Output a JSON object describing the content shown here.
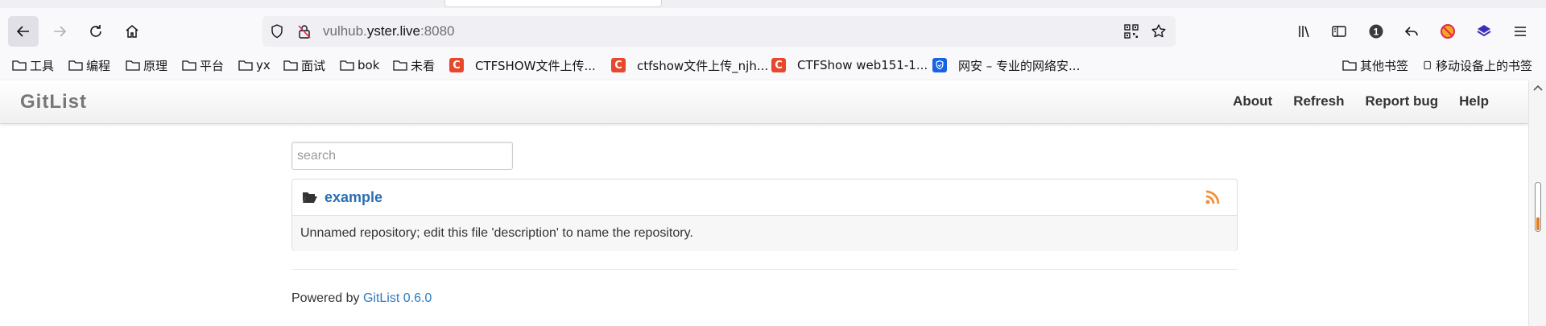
{
  "browser": {
    "url_prefix": "vulhub.",
    "url_domain": "yster.live",
    "url_port": ":8080",
    "badge_count": "1",
    "bookmarks": [
      {
        "label": "工具",
        "type": "folder"
      },
      {
        "label": "编程",
        "type": "folder"
      },
      {
        "label": "原理",
        "type": "folder"
      },
      {
        "label": "平台",
        "type": "folder"
      },
      {
        "label": "yx",
        "type": "folder"
      },
      {
        "label": "面试",
        "type": "folder"
      },
      {
        "label": "bok",
        "type": "folder"
      },
      {
        "label": "未看",
        "type": "folder"
      },
      {
        "label": "CTFSHOW文件上传...",
        "type": "site",
        "favicon": "C"
      },
      {
        "label": "ctfshow文件上传_njh...",
        "type": "site",
        "favicon": "C"
      },
      {
        "label": "CTFShow web151-1...",
        "type": "site",
        "favicon": "C"
      },
      {
        "label": "网安 – 专业的网络安...",
        "type": "site",
        "favicon": "shield"
      }
    ],
    "other_bookmarks": "其他书签",
    "mobile_bookmarks": "移动设备上的书签"
  },
  "page": {
    "brand": "GitList",
    "nav": [
      {
        "label": "About"
      },
      {
        "label": "Refresh"
      },
      {
        "label": "Report bug"
      },
      {
        "label": "Help"
      }
    ],
    "search": {
      "placeholder": "search",
      "value": ""
    },
    "repository": {
      "name": "example",
      "description": "Unnamed repository; edit this file 'description' to name the repository."
    },
    "footer": {
      "prefix": "Powered by ",
      "link": "GitList 0.6.0"
    }
  },
  "colors": {
    "link": "#2a6fb3",
    "rss": "#f2903a",
    "favicon_c": "#e8472b",
    "favicon_shield": "#1663e6"
  }
}
